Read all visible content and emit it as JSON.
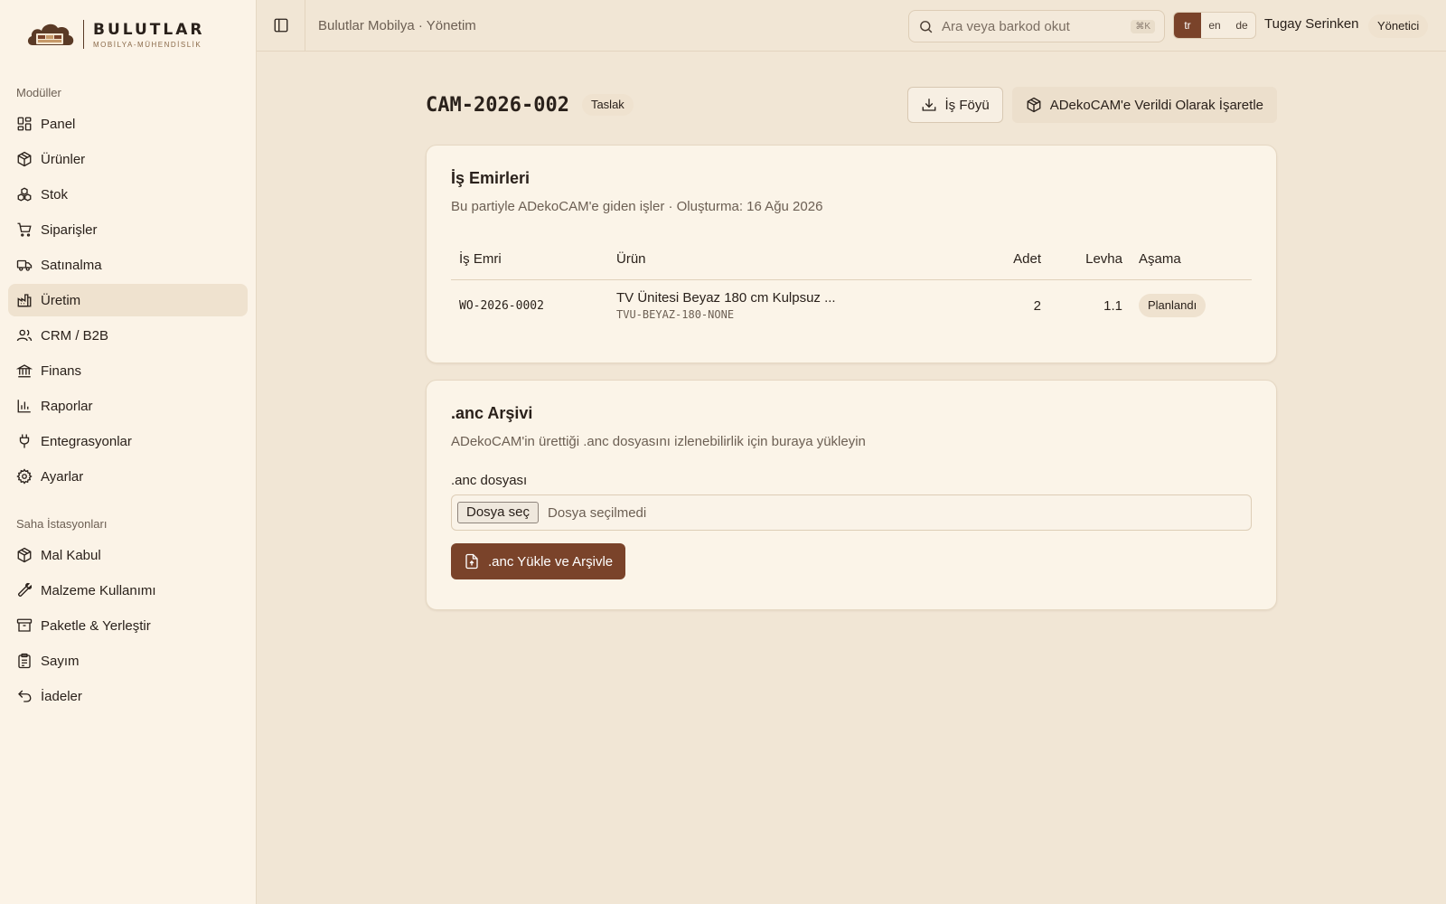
{
  "brand": {
    "name": "BULUTLAR",
    "subtitle": "MOBİLYA-MÜHENDİSLİK"
  },
  "sidebar": {
    "modules_title": "Modüller",
    "modules": [
      {
        "label": "Panel",
        "icon": "grid-icon"
      },
      {
        "label": "Ürünler",
        "icon": "package-icon"
      },
      {
        "label": "Stok",
        "icon": "boxes-icon"
      },
      {
        "label": "Siparişler",
        "icon": "cart-icon"
      },
      {
        "label": "Satınalma",
        "icon": "truck-icon"
      },
      {
        "label": "Üretim",
        "icon": "factory-icon",
        "active": true
      },
      {
        "label": "CRM / B2B",
        "icon": "users-icon"
      },
      {
        "label": "Finans",
        "icon": "bank-icon"
      },
      {
        "label": "Raporlar",
        "icon": "bar-chart-icon"
      },
      {
        "label": "Entegrasyonlar",
        "icon": "plug-icon"
      },
      {
        "label": "Ayarlar",
        "icon": "gear-icon"
      }
    ],
    "stations_title": "Saha İstasyonları",
    "stations": [
      {
        "label": "Mal Kabul",
        "icon": "package-icon"
      },
      {
        "label": "Malzeme Kullanımı",
        "icon": "wrench-icon"
      },
      {
        "label": "Paketle & Yerleştir",
        "icon": "archive-icon"
      },
      {
        "label": "Sayım",
        "icon": "clipboard-icon"
      },
      {
        "label": "İadeler",
        "icon": "undo-icon"
      }
    ]
  },
  "topbar": {
    "breadcrumb": "Bulutlar Mobilya · Yönetim",
    "search_placeholder": "Ara veya barkod okut",
    "search_shortcut": "⌘K",
    "languages": [
      "tr",
      "en",
      "de"
    ],
    "active_language": "tr",
    "user_name": "Tugay Serinken",
    "user_role": "Yönetici"
  },
  "page": {
    "title": "CAM-2026-002",
    "status": "Taslak",
    "actions": {
      "job_sheet": "İş Föyü",
      "mark_delivered": "ADekoCAM'e Verildi Olarak İşaretle"
    }
  },
  "work_orders": {
    "title": "İş Emirleri",
    "description": "Bu partiyle ADekoCAM'e giden işler · Oluşturma: 16 Ağu 2026",
    "columns": [
      "İş Emri",
      "Ürün",
      "Adet",
      "Levha",
      "Aşama"
    ],
    "rows": [
      {
        "id": "WO-2026-0002",
        "product_name": "TV Ünitesi Beyaz 180 cm Kulpsuz ...",
        "product_sku": "TVU-BEYAZ-180-NONE",
        "qty": "2",
        "sheets": "1.1",
        "stage": "Planlandı"
      }
    ]
  },
  "archive": {
    "title": ".anc Arşivi",
    "description": "ADekoCAM'in ürettiği .anc dosyasını izlenebilirlik için buraya yükleyin",
    "field_label": ".anc dosyası",
    "file_button": "Dosya seç",
    "file_status": "Dosya seçilmedi",
    "upload_button": ".anc Yükle ve Arşivle"
  },
  "colors": {
    "accent": "#7a432a",
    "background": "#f1e6d5",
    "sidebar": "#fbf3e7",
    "card": "#fbf4e8"
  }
}
